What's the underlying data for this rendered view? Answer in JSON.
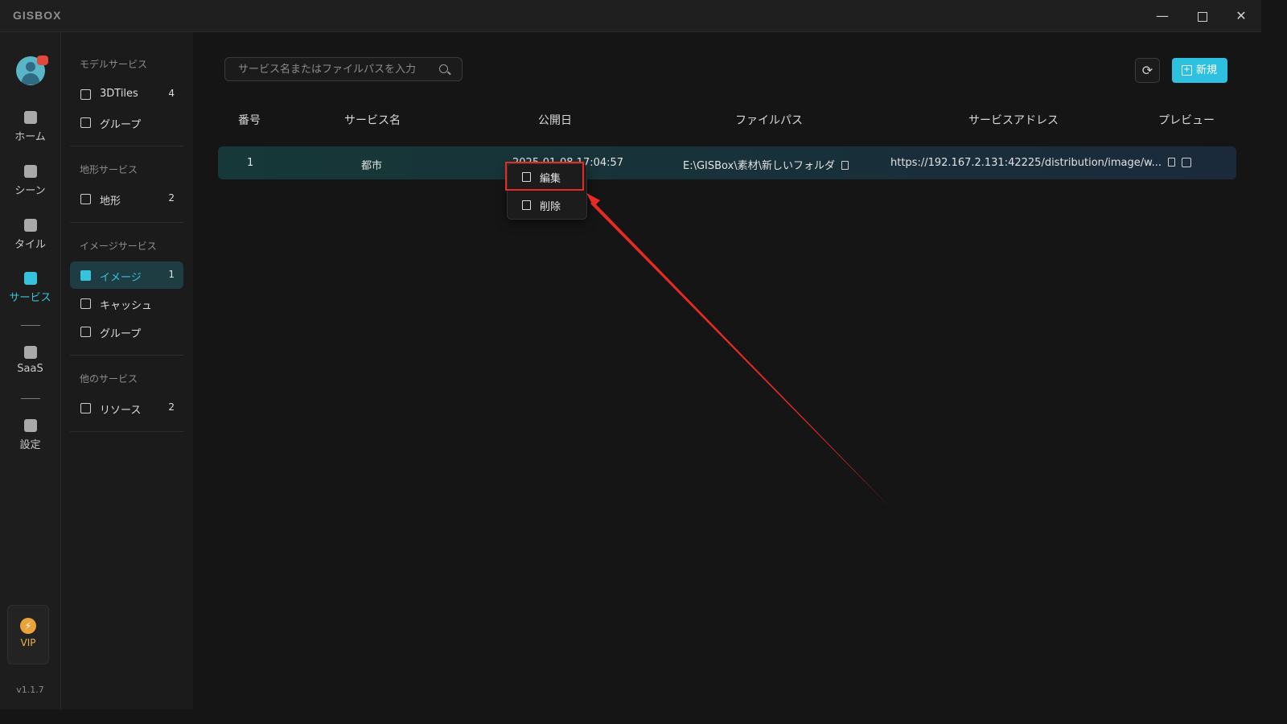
{
  "app": {
    "logo": "GISBOX",
    "version": "v1.1.7"
  },
  "window": {
    "minimize": "—",
    "close": "✕"
  },
  "nav": {
    "items": [
      {
        "label": "ホーム",
        "icon": "home-icon"
      },
      {
        "label": "シーン",
        "icon": "scene-icon"
      },
      {
        "label": "タイル",
        "icon": "tile-icon"
      },
      {
        "label": "サービス",
        "icon": "service-icon",
        "active": true
      },
      {
        "label": "SaaS",
        "icon": "saas-icon"
      },
      {
        "label": "設定",
        "icon": "settings-icon"
      }
    ],
    "vip_label": "VIP"
  },
  "sidebar": {
    "sections": [
      {
        "title": "モデルサービス",
        "items": [
          {
            "label": "3DTiles",
            "count": "4"
          },
          {
            "label": "グループ",
            "count": ""
          }
        ]
      },
      {
        "title": "地形サービス",
        "items": [
          {
            "label": "地形",
            "count": "2"
          }
        ]
      },
      {
        "title": "イメージサービス",
        "items": [
          {
            "label": "イメージ",
            "count": "1",
            "active": true
          },
          {
            "label": "キャッシュ",
            "count": ""
          },
          {
            "label": "グループ",
            "count": ""
          }
        ]
      },
      {
        "title": "他のサービス",
        "items": [
          {
            "label": "リソース",
            "count": "2"
          }
        ]
      }
    ]
  },
  "toolbar": {
    "search_placeholder": "サービス名またはファイルパスを入力",
    "new_label": "新規"
  },
  "table": {
    "columns": [
      "番号",
      "サービス名",
      "公開日",
      "ファイルパス",
      "サービスアドレス",
      "プレビュー"
    ],
    "rows": [
      {
        "number": "1",
        "name": "都市",
        "date": "2025-01-08 17:04:57",
        "path": "E:\\GISBox\\素材\\新しいフォルダ",
        "address": "https://192.167.2.131:42225/distribution/image/w..."
      }
    ]
  },
  "context_menu": {
    "edit": "編集",
    "delete": "削除"
  },
  "colors": {
    "accent": "#2ec1df",
    "highlight": "#e52b23"
  }
}
